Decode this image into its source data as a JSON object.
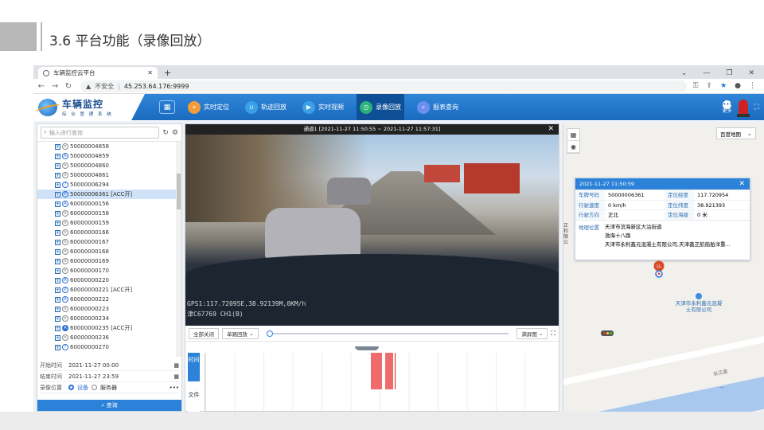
{
  "slide": {
    "title": "3.6 平台功能（录像回放）"
  },
  "browser": {
    "tab_title": "车辆监控云平台",
    "new_tab": "+",
    "security_label": "不安全",
    "url": "45.253.64.176:9999"
  },
  "app": {
    "logo_title": "车辆监控",
    "logo_subtitle": "综 合 管 理 系 统",
    "nav": [
      {
        "label": "实时定位",
        "color": "#f29b38",
        "icon": "location-icon"
      },
      {
        "label": "轨迹回放",
        "color": "#3aa1e6",
        "icon": "track-icon"
      },
      {
        "label": "实时视频",
        "color": "#3aa1e6",
        "icon": "play-icon"
      },
      {
        "label": "录像回放",
        "color": "#29b37a",
        "icon": "history-icon"
      },
      {
        "label": "报表查询",
        "color": "#6b8ef0",
        "icon": "search-report-icon"
      }
    ],
    "more_label": "更多"
  },
  "left_panel": {
    "search_placeholder": "输入进行查询",
    "vehicles": [
      {
        "id": "50000004858",
        "status": "offline"
      },
      {
        "id": "50000004859",
        "status": "a"
      },
      {
        "id": "50000004860",
        "status": "offline"
      },
      {
        "id": "50000004861",
        "status": "offline"
      },
      {
        "id": "50000006294",
        "status": "q"
      },
      {
        "id": "50000006361 [ACC开]",
        "status": "p",
        "selected": true
      },
      {
        "id": "60000000156",
        "status": "a"
      },
      {
        "id": "60000000158",
        "status": "offline"
      },
      {
        "id": "60000000159",
        "status": "offline"
      },
      {
        "id": "60000000166",
        "status": "offline"
      },
      {
        "id": "60000000167",
        "status": "offline"
      },
      {
        "id": "60000000168",
        "status": "offline"
      },
      {
        "id": "60000000169",
        "status": "offline"
      },
      {
        "id": "60000000170",
        "status": "offline"
      },
      {
        "id": "60000000220",
        "status": "a"
      },
      {
        "id": "60000000221 [ACC开]",
        "status": "p"
      },
      {
        "id": "60000000222",
        "status": "a"
      },
      {
        "id": "60000000223",
        "status": "offline"
      },
      {
        "id": "60000000234",
        "status": "offline"
      },
      {
        "id": "60000000235 [ACC开]",
        "status": "a-on"
      },
      {
        "id": "60000000236",
        "status": "offline"
      },
      {
        "id": "60000000270",
        "status": "q"
      }
    ],
    "start_label": "开始时间",
    "start_value": "2021-11-27  00:00",
    "end_label": "结束时间",
    "end_value": "2021-11-27  23:59",
    "location_label": "录像位置",
    "opt_device": "设备",
    "opt_server": "服务器",
    "query_button": "查询"
  },
  "video": {
    "header": "通道1 [2021-11-27 11:50:55 ~ 2021-11-27 11:57:31]",
    "overlay_gps": "GPS1:117.72095E,38.92139M,0KM/h",
    "overlay_ch": "津C67769  CH1(B)",
    "close_all": "全部关闭",
    "playback_mode": "单路回放",
    "fit_mode": "满屏图",
    "timeline_time_label": "时间",
    "timeline_file_label": "文件"
  },
  "map": {
    "map_type": "百度地图",
    "popup_time": "2021-11-27 11:50:59",
    "fields": [
      {
        "label": "车牌号码",
        "value": "50000006361",
        "label2": "定位经度",
        "value2": "117.720954"
      },
      {
        "label": "行驶速度",
        "value": "0 km/h",
        "label2": "定位纬度",
        "value2": "38.921393"
      },
      {
        "label": "行驶方向",
        "value": "正北",
        "label2": "定位海拔",
        "value2": "0 米"
      }
    ],
    "address_label": "地理位置",
    "address_lines": [
      "天津市滨海新区大沽街道",
      "渤海十八路",
      "天津市永利鑫元混凝土有限公司,天津鑫正航船舶洋重..."
    ],
    "poi_name": "天津市永利鑫元混凝土有限公司",
    "road_name": "长江道",
    "side_text": "正和限公",
    "marker_label": "LL"
  }
}
